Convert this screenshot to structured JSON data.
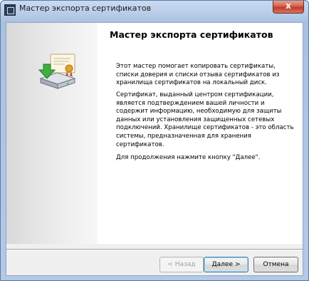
{
  "window": {
    "title": "Мастер экспорта сертификатов",
    "close_label": "x"
  },
  "wizard": {
    "heading": "Мастер экспорта сертификатов",
    "intro": "Этот мастер помогает копировать сертификаты, списки доверия и списки отзыва сертификатов из хранилища сертификатов на локальный диск.",
    "description": "Сертификат, выданный центром сертификации, является подтверждением вашей личности и содержит информацию, необходимую для защиты данных или установления защищенных сетевых подключений. Хранилище сертификатов - это область системы, предназначенная для хранения сертификатов.",
    "continue_hint": "Для продолжения нажмите кнопку \"Далее\".",
    "icon": "certificate-export-icon"
  },
  "buttons": {
    "back": "< Назад",
    "next": "Далее >",
    "cancel": "Отмена"
  },
  "colors": {
    "titlebar": "#bcd0ea",
    "close_button": "#c0392b",
    "default_button_border": "#3c7fb1"
  }
}
